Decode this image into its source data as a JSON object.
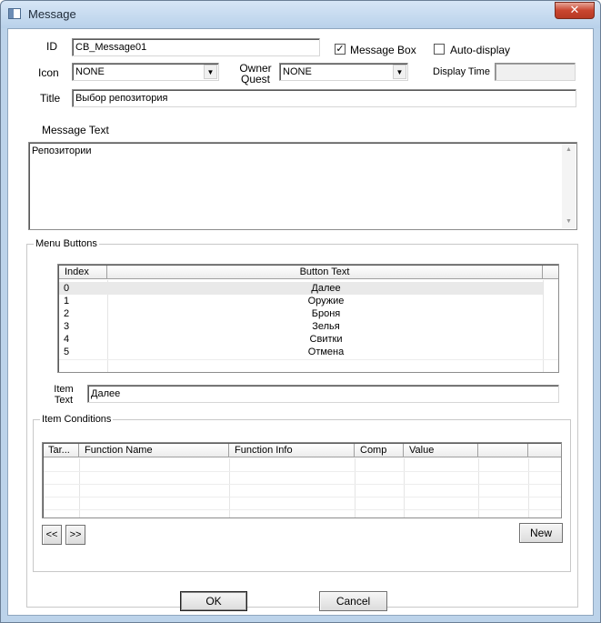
{
  "window": {
    "title": "Message",
    "close_glyph": "✕"
  },
  "form": {
    "id_label": "ID",
    "id_value": "CB_Message01",
    "message_box_label": "Message Box",
    "message_box_checked": true,
    "auto_display_label": "Auto-display",
    "auto_display_checked": false,
    "icon_label": "Icon",
    "icon_value": "NONE",
    "owner_quest_label_1": "Owner",
    "owner_quest_label_2": "Quest",
    "owner_quest_value": "NONE",
    "display_time_label": "Display Time",
    "display_time_value": "",
    "title_label": "Title",
    "title_value": "Выбор репозитория",
    "message_text_label": "Message Text",
    "message_text_value": "Репозитории"
  },
  "menu_buttons": {
    "group_title": "Menu Buttons",
    "columns": [
      "Index",
      "Button Text"
    ],
    "rows": [
      {
        "index": "0",
        "text": "Далее"
      },
      {
        "index": "1",
        "text": "Оружие"
      },
      {
        "index": "2",
        "text": "Броня"
      },
      {
        "index": "3",
        "text": "Зелья"
      },
      {
        "index": "4",
        "text": "Свитки"
      },
      {
        "index": "5",
        "text": "Отмена"
      }
    ],
    "selected_index": 0,
    "item_text_label_1": "Item",
    "item_text_label_2": "Text",
    "item_text_value": "Далее"
  },
  "item_conditions": {
    "group_title": "Item Conditions",
    "columns": [
      "Tar...",
      "Function Name",
      "Function Info",
      "Comp",
      "Value",
      "",
      ""
    ],
    "prev_label": "<<",
    "next_label": ">>",
    "new_label": "New"
  },
  "footer": {
    "ok_label": "OK",
    "cancel_label": "Cancel"
  },
  "colors": {
    "frame": "#bcd3ea",
    "close": "#c9452f",
    "selected_row": "#e9e9e9"
  },
  "icons": {
    "checkmark": "checkmark-icon",
    "dropdown": "chevron-down-icon"
  }
}
